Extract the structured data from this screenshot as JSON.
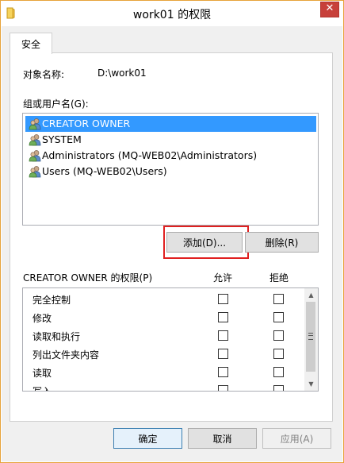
{
  "window": {
    "title": "work01 的权限",
    "close_label": "✕"
  },
  "tab": {
    "label": "安全"
  },
  "object": {
    "label": "对象名称:",
    "value": "D:\\work01"
  },
  "groups": {
    "label": "组或用户名(G):",
    "items": [
      {
        "name": "CREATOR OWNER",
        "selected": true
      },
      {
        "name": "SYSTEM",
        "selected": false
      },
      {
        "name": "Administrators (MQ-WEB02\\Administrators)",
        "selected": false
      },
      {
        "name": "Users (MQ-WEB02\\Users)",
        "selected": false
      }
    ],
    "icon": "users-icon"
  },
  "buttons": {
    "add": "添加(D)...",
    "remove": "删除(R)"
  },
  "permissions": {
    "label": "CREATOR OWNER 的权限(P)",
    "allow_header": "允许",
    "deny_header": "拒绝",
    "rows": [
      {
        "name": "完全控制",
        "allow": false,
        "deny": false
      },
      {
        "name": "修改",
        "allow": false,
        "deny": false
      },
      {
        "name": "读取和执行",
        "allow": false,
        "deny": false
      },
      {
        "name": "列出文件夹内容",
        "allow": false,
        "deny": false
      },
      {
        "name": "读取",
        "allow": false,
        "deny": false
      },
      {
        "name": "写入",
        "allow": false,
        "deny": false
      }
    ]
  },
  "footer": {
    "ok": "确定",
    "cancel": "取消",
    "apply": "应用(A)"
  },
  "colors": {
    "selection": "#3399ff",
    "highlight_box": "#e02020",
    "close": "#c7403a"
  }
}
